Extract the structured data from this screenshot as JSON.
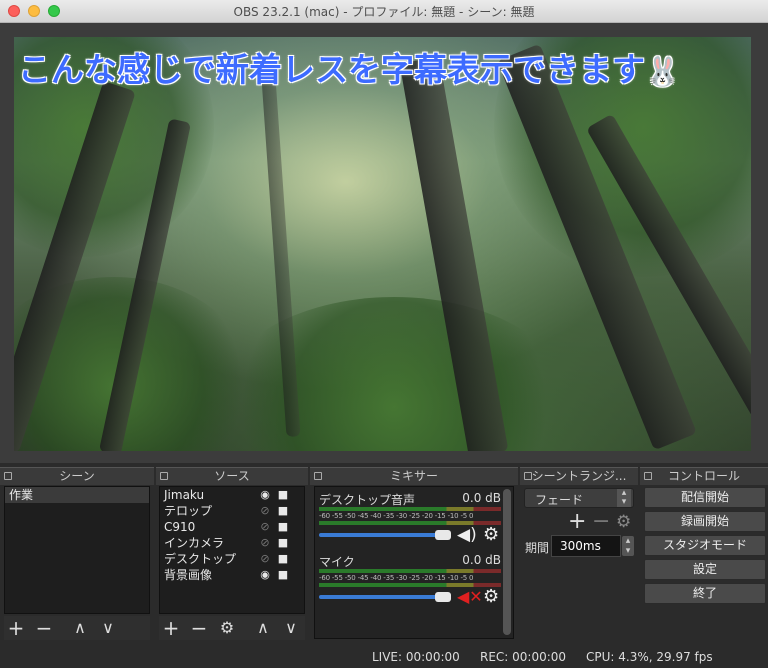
{
  "window": {
    "title": "OBS 23.2.1 (mac) - プロファイル: 無題 - シーン: 無題"
  },
  "preview": {
    "caption": "こんな感じで新着レスを字幕表示できます",
    "caption_emoji": "🐰"
  },
  "docks": {
    "scenes": "シーン",
    "sources": "ソース",
    "mixer": "ミキサー",
    "transitions": "シーントランジ...",
    "controls": "コントロール"
  },
  "scenes": {
    "items": [
      "作業"
    ]
  },
  "sources": {
    "items": [
      {
        "name": "Jimaku",
        "visible": true
      },
      {
        "name": "テロップ",
        "visible": false
      },
      {
        "name": "C910",
        "visible": false
      },
      {
        "name": "インカメラ",
        "visible": false
      },
      {
        "name": "デスクトップ",
        "visible": false
      },
      {
        "name": "背景画像",
        "visible": true
      }
    ]
  },
  "mixer": {
    "tracks": [
      {
        "name": "デスクトップ音声",
        "level": "0.0 dB",
        "muted": false
      },
      {
        "name": "マイク",
        "level": "0.0 dB",
        "muted": true
      }
    ],
    "ticks": "-60 -55 -50 -45 -40 -35 -30 -25 -20 -15 -10 -5  0"
  },
  "transitions": {
    "selected": "フェード",
    "duration_label": "期間",
    "duration_value": "300ms"
  },
  "controls": {
    "start_stream": "配信開始",
    "start_record": "録画開始",
    "studio_mode": "スタジオモード",
    "settings": "設定",
    "exit": "終了"
  },
  "status": {
    "live": "LIVE: 00:00:00",
    "rec": "REC: 00:00:00",
    "cpu": "CPU: 4.3%, 29.97 fps"
  },
  "icons": {
    "add": "+",
    "remove": "−",
    "up": "∧",
    "down": "∨",
    "gear": "⚙",
    "eye": "👁",
    "lock": "🔒",
    "speaker": "🔊",
    "muted_speaker": "🔇"
  },
  "colors": {
    "caption": "#3d6bff",
    "fader": "#3a7bd5",
    "mute": "#e02020"
  }
}
